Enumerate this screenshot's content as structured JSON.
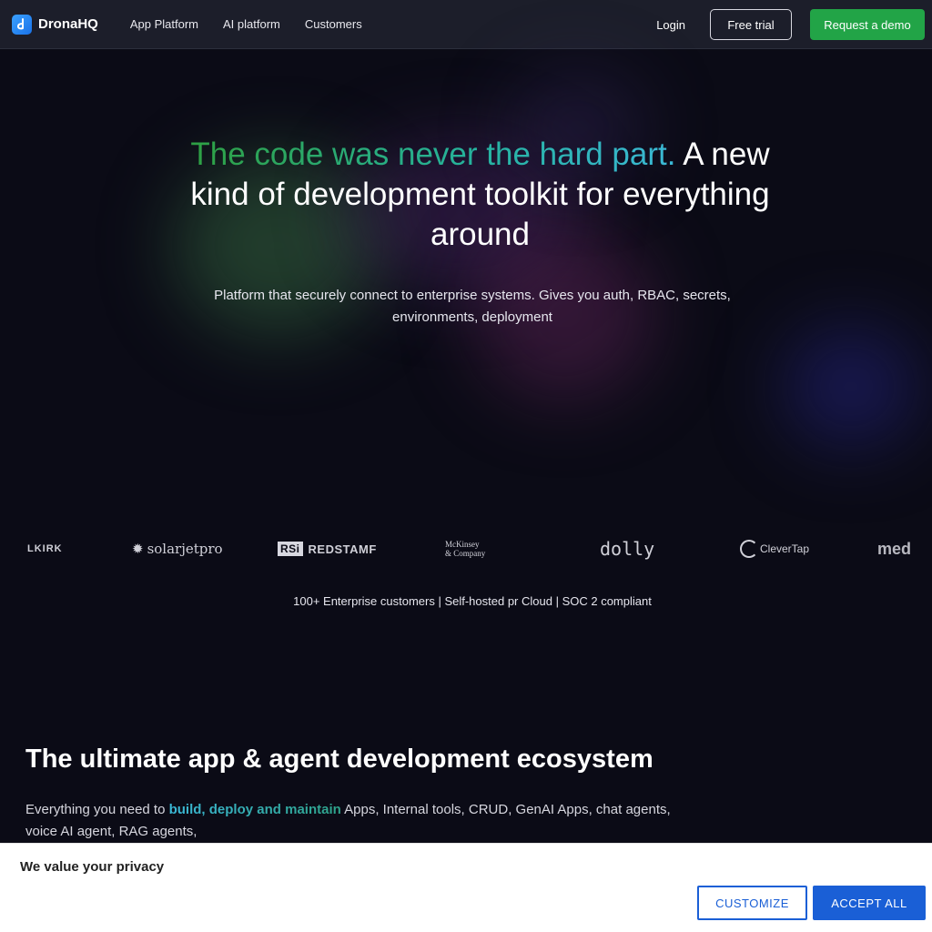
{
  "nav": {
    "brand": "DronaHQ",
    "links": [
      "App Platform",
      "AI platform",
      "Customers"
    ],
    "login": "Login",
    "free_trial": "Free trial",
    "request_demo": "Request a demo"
  },
  "hero": {
    "title_highlight": "The code was never the hard part.",
    "title_rest": " A new kind of development toolkit for everything around",
    "subtitle": "Platform that securely connect to enterprise systems. Gives you auth, RBAC, secrets, environments, deployment"
  },
  "logos": {
    "kirk": "LKIRK",
    "solar": "solarjetpro",
    "rsi": "RSi",
    "redstamp": "REDSTAMF",
    "mckinsey_line1": "McKinsey",
    "mckinsey_line2": "& Company",
    "dolly": "dolly",
    "clevertap": "CleverTap",
    "med": "med"
  },
  "stats": "100+ Enterprise customers | Self-hosted pr Cloud | SOC 2 compliant",
  "ecosystem": {
    "title": "The ultimate app & agent development ecosystem",
    "desc_before": "Everything you need to ",
    "desc_highlight": "build, deploy and maintain",
    "desc_after": " Apps, Internal tools, CRUD, GenAI Apps, chat agents, voice AI agent, RAG agents,"
  },
  "cookie": {
    "title": "We value your privacy",
    "customize": "CUSTOMIZE",
    "accept": "ACCEPT ALL"
  },
  "colors": {
    "background": "#0b0b16",
    "nav": "#1c1e2a",
    "demo_button": "#22a447",
    "cookie_button": "#1a5fd6"
  }
}
